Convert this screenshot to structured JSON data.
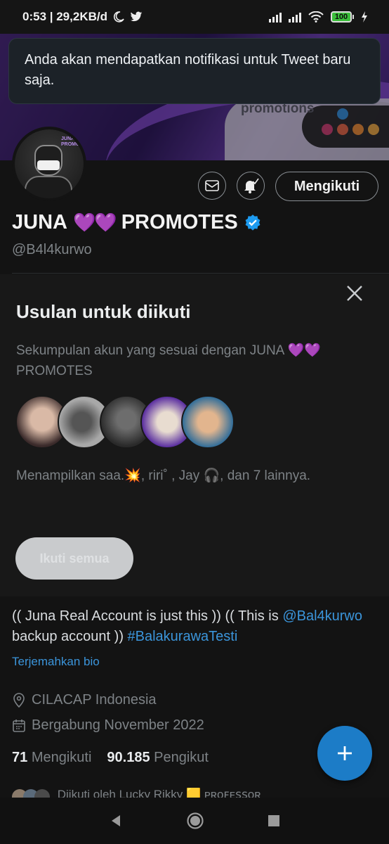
{
  "status_bar": {
    "time_speed": "0:53 | 29,2KB/d",
    "battery": "100"
  },
  "toast": {
    "message": "Anda akan mendapatkan notifikasi untuk Tweet baru saja."
  },
  "banner": {
    "dm_text": "DM for promotions"
  },
  "avatar": {
    "logo_text": "JUNA PROMOTES"
  },
  "actions": {
    "follow_label": "Mengikuti"
  },
  "profile": {
    "name_first": "JUNA",
    "hearts": "💜💜",
    "name_last": "PROMOTES",
    "handle": "@B4l4kurwo"
  },
  "suggestions": {
    "title": "Usulan untuk diikuti",
    "subtitle": "Sekumpulan akun yang sesuai dengan JUNA 💜💜 PROMOTES",
    "showing": "Menampilkan saa.💥, riri˚  , Jay 🎧, dan 7 lainnya.",
    "follow_all_label": "Ikuti semua"
  },
  "bio": {
    "part1": "(( Juna Real Account is just this ))  (( This is ",
    "mention": "@Bal4kurwo",
    "part2": " backup account ))  ",
    "hashtag": "#BalakurawaTesti",
    "translate_label": "Terjemahkan bio"
  },
  "meta": {
    "location": "CILACAP Indonesia",
    "joined": "Bergabung November 2022"
  },
  "stats": {
    "following_count": "71",
    "following_label": "Mengikuti",
    "followers_count": "90.185",
    "followers_label": "Pengikut"
  },
  "followed_by": {
    "text": "Diikuti oleh Lucky Rikky 🟨 ᴘʀᴏꜰᴇꜱꜱᴏʀ"
  },
  "colors": {
    "accent": "#1d9bf0",
    "fab": "#1c7cc7",
    "heart": "#8c32d6"
  },
  "icons": [
    "twitter-icon",
    "moon-icon",
    "signal-icon",
    "wifi-icon",
    "mail-icon",
    "bell-check-icon",
    "verified-icon",
    "close-icon",
    "location-icon",
    "calendar-icon",
    "plus-icon",
    "back-icon",
    "home-icon",
    "recents-icon"
  ]
}
